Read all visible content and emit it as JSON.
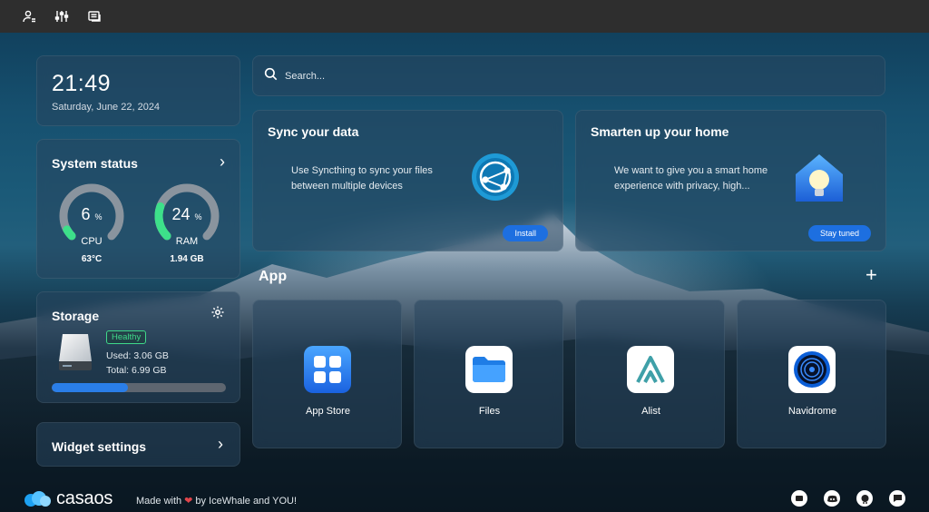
{
  "topbar": {
    "icons": [
      "user-settings-icon",
      "sliders-icon",
      "screen-icon"
    ]
  },
  "clock": {
    "time": "21:49",
    "date": "Saturday, June 22, 2024"
  },
  "system_status": {
    "title": "System status",
    "cpu": {
      "value": "6",
      "unit": "%",
      "label": "CPU",
      "temp": "63°C",
      "percent": 6
    },
    "ram": {
      "value": "24",
      "unit": "%",
      "label": "RAM",
      "used": "1.94 GB",
      "percent": 24
    }
  },
  "storage": {
    "title": "Storage",
    "health": "Healthy",
    "used": "Used: 3.06 GB",
    "total": "Total: 6.99 GB",
    "fraction": 0.44
  },
  "widget_settings": {
    "title": "Widget settings"
  },
  "search": {
    "placeholder": "Search..."
  },
  "promos": [
    {
      "title": "Sync your data",
      "desc": "Use Syncthing to sync your files between multiple devices",
      "button": "Install"
    },
    {
      "title": "Smarten up your home",
      "desc": "We want to give you a smart home experience with privacy, high...",
      "button": "Stay tuned"
    }
  ],
  "apps_section": {
    "title": "App"
  },
  "apps": [
    {
      "name": "App Store"
    },
    {
      "name": "Files"
    },
    {
      "name": "Alist"
    },
    {
      "name": "Navidrome"
    }
  ],
  "footer": {
    "logo": "casaos",
    "made_with": "Made with",
    "by": "by IceWhale and YOU!"
  },
  "colors": {
    "accent": "#1d6fe0",
    "healthy": "#3fd98a",
    "cpu_ring": "#3de08a",
    "topbar": "#2e2e2e"
  }
}
